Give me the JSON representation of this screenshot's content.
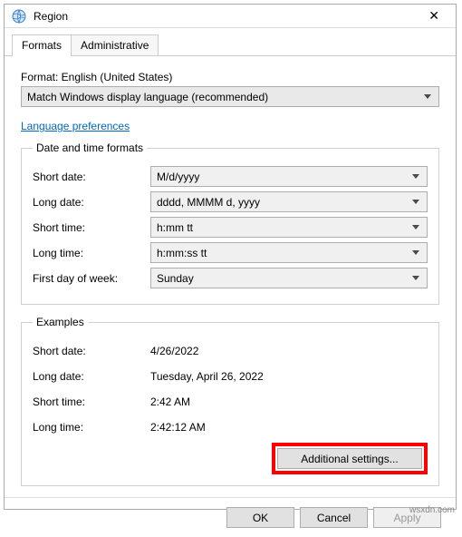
{
  "window": {
    "title": "Region",
    "close_label": "✕"
  },
  "tabs": {
    "formats": "Formats",
    "administrative": "Administrative"
  },
  "format": {
    "label": "Format: English (United States)",
    "selected": "Match Windows display language (recommended)"
  },
  "links": {
    "language_prefs": "Language preferences"
  },
  "dt_group": {
    "legend": "Date and time formats",
    "short_date_lbl": "Short date:",
    "short_date_val": "M/d/yyyy",
    "long_date_lbl": "Long date:",
    "long_date_val": "dddd, MMMM d, yyyy",
    "short_time_lbl": "Short time:",
    "short_time_val": "h:mm tt",
    "long_time_lbl": "Long time:",
    "long_time_val": "h:mm:ss tt",
    "first_day_lbl": "First day of week:",
    "first_day_val": "Sunday"
  },
  "examples": {
    "legend": "Examples",
    "short_date_lbl": "Short date:",
    "short_date_val": "4/26/2022",
    "long_date_lbl": "Long date:",
    "long_date_val": "Tuesday, April 26, 2022",
    "short_time_lbl": "Short time:",
    "short_time_val": "2:42 AM",
    "long_time_lbl": "Long time:",
    "long_time_val": "2:42:12 AM",
    "additional": "Additional settings..."
  },
  "buttons": {
    "ok": "OK",
    "cancel": "Cancel",
    "apply": "Apply"
  },
  "footer": "wsxdn.com"
}
